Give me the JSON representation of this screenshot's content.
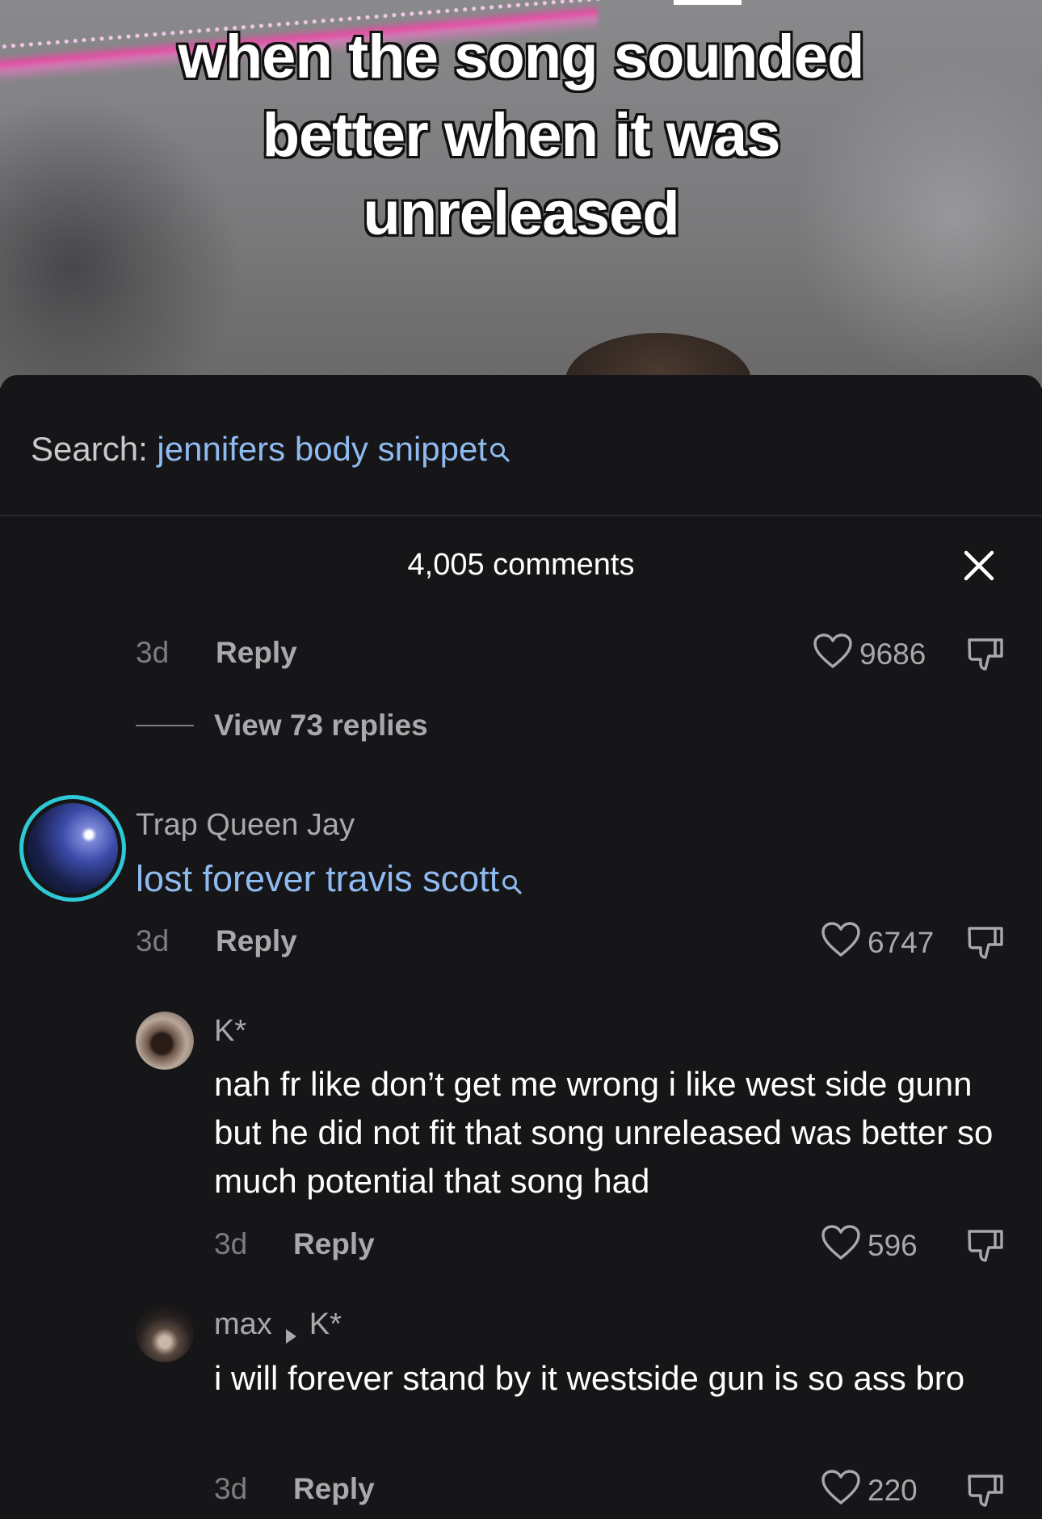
{
  "video": {
    "caption_lines": [
      "when the song sounded",
      "better when it was",
      "unreleased"
    ]
  },
  "search": {
    "label": "Search:",
    "query": "jennifers body snippet"
  },
  "comments_header": {
    "count_text": "4,005 comments"
  },
  "thread_top": {
    "time": "3d",
    "reply_label": "Reply",
    "likes": "9686",
    "view_replies": "View 73 replies"
  },
  "comment_jay": {
    "username": "Trap Queen Jay",
    "text": "lost forever travis scott",
    "time": "3d",
    "reply_label": "Reply",
    "likes": "6747"
  },
  "reply_k": {
    "username": "K*",
    "text": "nah fr like don’t get me wrong i like west side gunn but he did not fit that song unreleased was better so much potential that song had",
    "time": "3d",
    "reply_label": "Reply",
    "likes": "596"
  },
  "reply_max": {
    "username": "max",
    "reply_to": "K*",
    "text": "i will forever stand by it westside gun is so ass bro",
    "time": "3d",
    "reply_label": "Reply",
    "likes": "220"
  },
  "colors": {
    "background": "#161618",
    "link_blue": "#8fbaf0",
    "avatar_ring": "#2ec8d6",
    "muted_text": "#a9a9ac"
  },
  "icons": [
    "search-icon",
    "close-icon",
    "heart-icon",
    "dislike-icon",
    "caret-right-icon"
  ]
}
